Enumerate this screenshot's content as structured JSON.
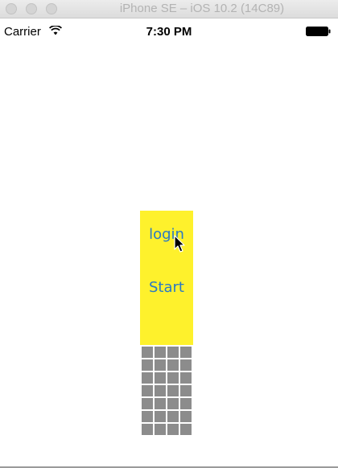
{
  "simulator": {
    "title": "iPhone SE – iOS 10.2 (14C89)"
  },
  "status_bar": {
    "carrier": "Carrier",
    "time": "7:30 PM",
    "wifi_icon": "wifi-icon",
    "battery_icon": "battery-icon"
  },
  "panel": {
    "background": "#fef12c",
    "login_label": "login",
    "start_label": "Start",
    "button_color": "#2a79c4"
  },
  "tile_grid": {
    "rows": 7,
    "columns": 4,
    "tile_color": "#8c8c8c"
  }
}
